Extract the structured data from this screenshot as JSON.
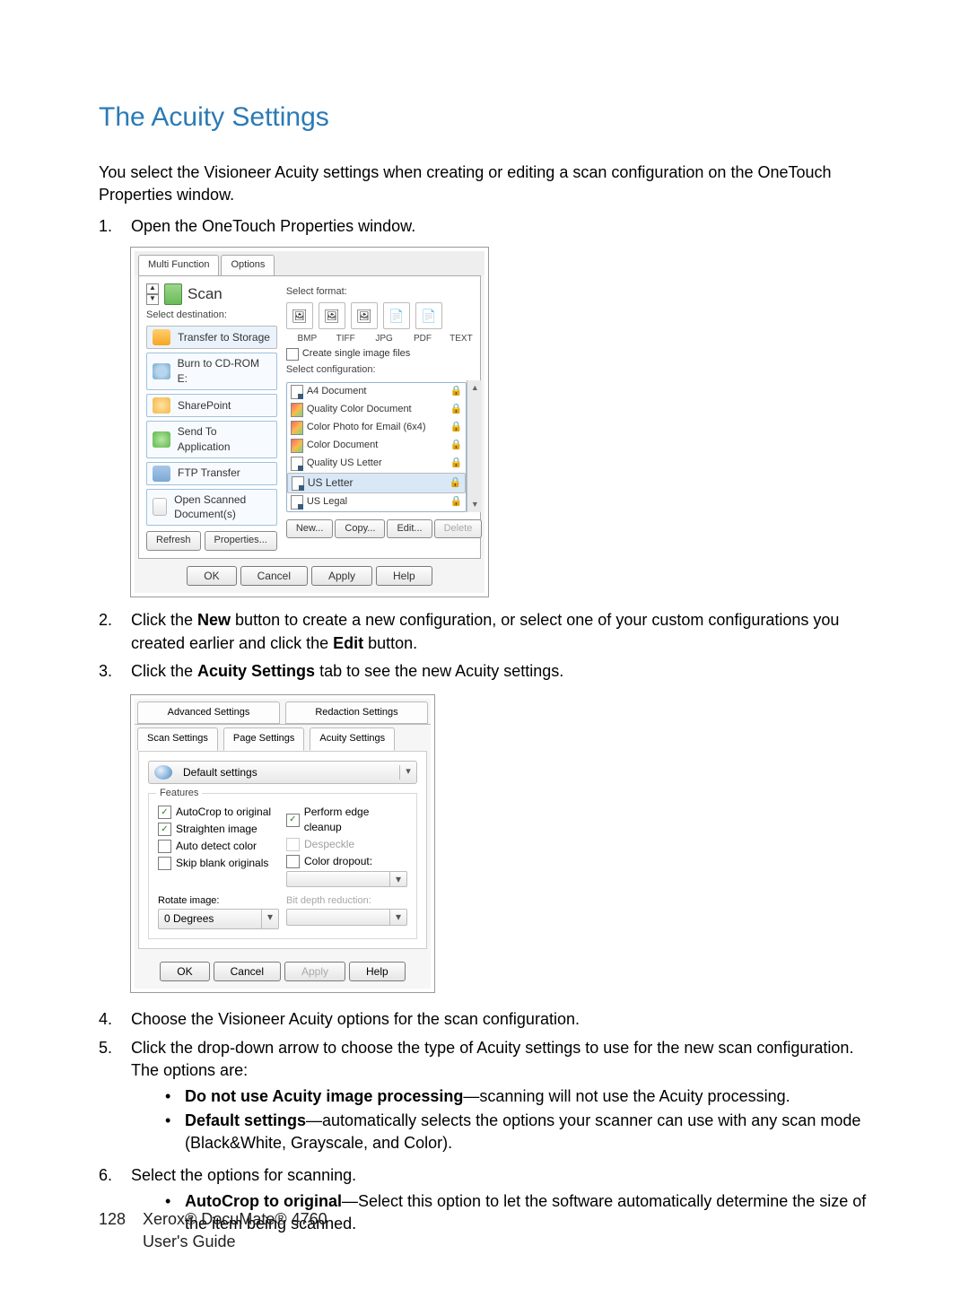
{
  "heading": "The Acuity Settings",
  "intro": "You select the Visioneer Acuity settings when creating or editing a scan configuration on the OneTouch Properties window.",
  "steps": {
    "s1": "Open the OneTouch Properties window.",
    "s2_a": "Click the ",
    "s2_b": " button to create a new configuration, or select one of your custom configurations you created earlier and click the ",
    "s2_c": " button.",
    "s2_new": "New",
    "s2_edit": "Edit",
    "s3_a": "Click the ",
    "s3_tab": "Acuity Settings",
    "s3_b": " tab to see the new Acuity settings.",
    "s4": "Choose the Visioneer Acuity options for the scan configuration.",
    "s5": "Click the drop-down arrow to choose the type of Acuity settings to use for the new scan configuration. The options are:",
    "s5_b1_t": "Do not use Acuity image processing",
    "s5_b1_r": "—scanning will not use the Acuity processing.",
    "s5_b2_t": "Default settings",
    "s5_b2_r": "—automatically selects the options your scanner can use with any scan mode (Black&White, Grayscale, and Color).",
    "s6": "Select the options for scanning.",
    "s6_b1_t": "AutoCrop to original",
    "s6_b1_r": "—Select this option to let the software automatically determine the size of the item being scanned."
  },
  "shot1": {
    "tab_multi": "Multi Function",
    "tab_options": "Options",
    "scan": "Scan",
    "sel_dest": "Select destination:",
    "dests": {
      "d0": "Transfer to Storage",
      "d1": "Burn to CD-ROM  E:",
      "d2": "SharePoint",
      "d3": "Send To Application",
      "d4": "FTP Transfer",
      "d5": "Open Scanned Document(s)"
    },
    "refresh": "Refresh",
    "properties": "Properties...",
    "sel_format": "Select format:",
    "fmts": {
      "f0": "BMP",
      "f1": "TIFF",
      "f2": "JPG",
      "f3": "PDF",
      "f4": "TEXT"
    },
    "create_single": "Create single image files",
    "sel_config": "Select configuration:",
    "cfgs": {
      "c0": "A4 Document",
      "c1": "Quality Color Document",
      "c2": "Color Photo for Email (6x4)",
      "c3": "Color Document",
      "c4": "Quality US Letter",
      "c5": "US Letter",
      "c6": "US Legal"
    },
    "new": "New...",
    "copy": "Copy...",
    "edit": "Edit...",
    "delete": "Delete",
    "ok": "OK",
    "cancel": "Cancel",
    "apply": "Apply",
    "help": "Help"
  },
  "shot2": {
    "tabs": {
      "t_adv": "Advanced Settings",
      "t_red": "Redaction Settings",
      "t_scan": "Scan Settings",
      "t_page": "Page Settings",
      "t_acu": "Acuity Settings"
    },
    "preset": "Default settings",
    "features": "Features",
    "opts": {
      "o1": "AutoCrop to original",
      "o2": "Straighten image",
      "o3": "Auto detect color",
      "o4": "Skip blank originals",
      "o5": "Perform edge cleanup",
      "o6": "Despeckle",
      "o7": "Color dropout:"
    },
    "rotate_label": "Rotate image:",
    "rotate_val": "0 Degrees",
    "bitdepth": "Bit depth reduction:",
    "ok": "OK",
    "cancel": "Cancel",
    "apply": "Apply",
    "help": "Help"
  },
  "footer": {
    "page": "128",
    "line1": "Xerox® DocuMate® 4760",
    "line2": "User's Guide"
  }
}
